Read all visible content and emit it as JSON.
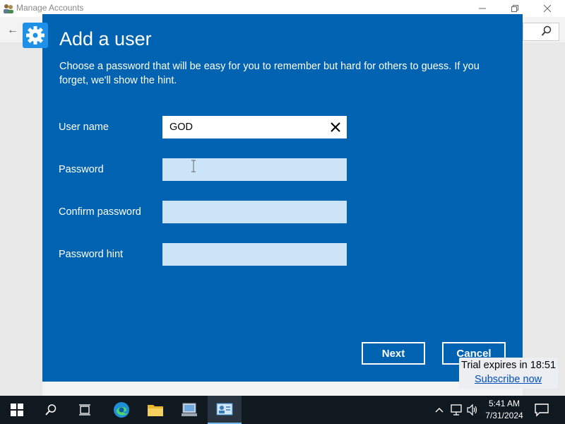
{
  "background_window": {
    "title": "Manage Accounts"
  },
  "dialog": {
    "title": "Add a user",
    "description": "Choose a password that will be easy for you to remember but hard for others to guess. If you forget, we'll show the hint.",
    "fields": {
      "username": {
        "label": "User name",
        "value": "GOD"
      },
      "password": {
        "label": "Password",
        "value": ""
      },
      "confirm_password": {
        "label": "Confirm password",
        "value": ""
      },
      "password_hint": {
        "label": "Password hint",
        "value": ""
      }
    },
    "buttons": {
      "next": "Next",
      "cancel": "Cancel"
    }
  },
  "trial_banner": {
    "text": "Trial expires in 18:51",
    "link": "Subscribe now"
  },
  "taskbar": {
    "time": "5:41 AM",
    "date": "7/31/2024"
  },
  "colors": {
    "dialog_bg": "#0063b1",
    "input_bg": "#cce4f7",
    "taskbar_bg": "#101820"
  }
}
